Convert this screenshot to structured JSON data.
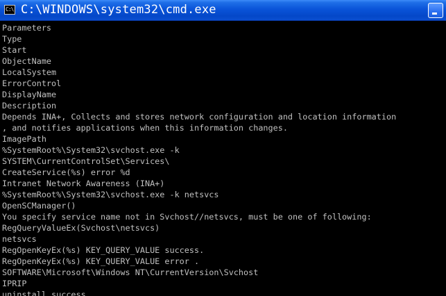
{
  "window": {
    "title": "C:\\WINDOWS\\system32\\cmd.exe",
    "icon": "cmd-icon",
    "icon_glyph": "C:\\"
  },
  "terminal": {
    "lines": [
      "Parameters",
      "Type",
      "Start",
      "ObjectName",
      "LocalSystem",
      "ErrorControl",
      "DisplayName",
      "Description",
      "Depends INA+, Collects and stores network configuration and location information",
      ", and notifies applications when this information changes.",
      "ImagePath",
      "%SystemRoot%\\System32\\svchost.exe -k",
      "SYSTEM\\CurrentControlSet\\Services\\",
      "CreateService(%s) error %d",
      "Intranet Network Awareness (INA+)",
      "%SystemRoot%\\System32\\svchost.exe -k netsvcs",
      "OpenSCManager()",
      "You specify service name not in Svchost//netsvcs, must be one of following:",
      "RegQueryValueEx(Svchost\\netsvcs)",
      "netsvcs",
      "RegOpenKeyEx(%s) KEY_QUERY_VALUE success.",
      "RegOpenKeyEx(%s) KEY_QUERY_VALUE error .",
      "SOFTWARE\\Microsoft\\Windows NT\\CurrentVersion\\Svchost",
      "IPRIP",
      "uninstall success"
    ],
    "text_color": "#c0c0c0",
    "background": "#000000"
  }
}
